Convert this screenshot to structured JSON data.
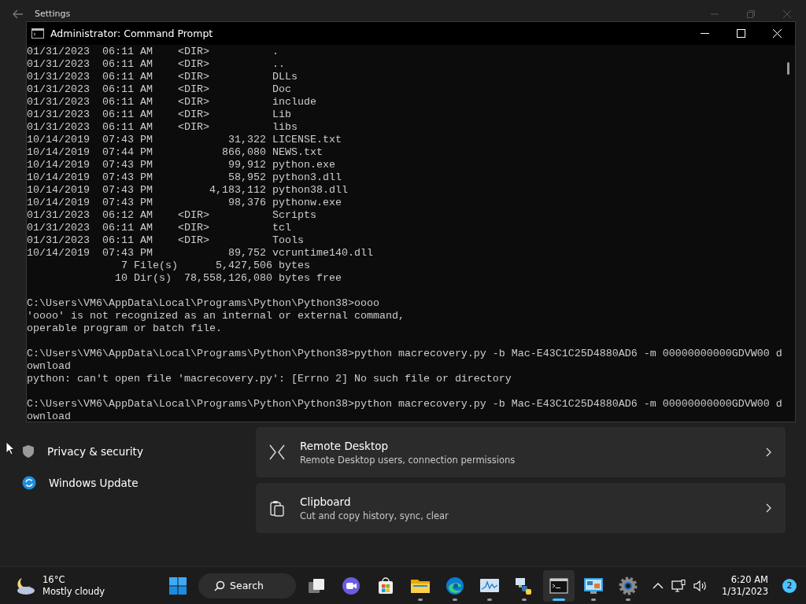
{
  "settings": {
    "title": "Settings",
    "nav": [
      {
        "label": "Privacy & security",
        "kind": "privacy"
      },
      {
        "label": "Windows Update",
        "kind": "update"
      }
    ],
    "cards": [
      {
        "title": "Remote Desktop",
        "description": "Remote Desktop users, connection permissions",
        "kind": "remote"
      },
      {
        "title": "Clipboard",
        "description": "Cut and copy history, sync, clear",
        "kind": "clipboard"
      }
    ]
  },
  "console": {
    "title": "Administrator:  Command Prompt",
    "blocks": [
      [
        "01/31/2023  06:11 AM    <DIR>          .",
        "01/31/2023  06:11 AM    <DIR>          ..",
        "01/31/2023  06:11 AM    <DIR>          DLLs",
        "01/31/2023  06:11 AM    <DIR>          Doc",
        "01/31/2023  06:11 AM    <DIR>          include",
        "01/31/2023  06:11 AM    <DIR>          Lib",
        "01/31/2023  06:11 AM    <DIR>          libs",
        "10/14/2019  07:43 PM            31,322 LICENSE.txt",
        "10/14/2019  07:44 PM           866,080 NEWS.txt",
        "10/14/2019  07:43 PM            99,912 python.exe",
        "10/14/2019  07:43 PM            58,952 python3.dll",
        "10/14/2019  07:43 PM         4,183,112 python38.dll",
        "10/14/2019  07:43 PM            98,376 pythonw.exe",
        "01/31/2023  06:12 AM    <DIR>          Scripts",
        "01/31/2023  06:11 AM    <DIR>          tcl",
        "01/31/2023  06:11 AM    <DIR>          Tools",
        "10/14/2019  07:43 PM            89,752 vcruntime140.dll",
        "               7 File(s)      5,427,506 bytes",
        "              10 Dir(s)  78,558,126,080 bytes free"
      ],
      [
        "C:\\Users\\VM6\\AppData\\Local\\Programs\\Python\\Python38>oooo",
        "'oooo' is not recognized as an internal or external command,",
        "operable program or batch file."
      ],
      [
        "C:\\Users\\VM6\\AppData\\Local\\Programs\\Python\\Python38>python macrecovery.py -b Mac-E43C1C25D4880AD6 -m 00000000000GDVW00 d",
        "ownload",
        "python: can't open file 'macrecovery.py': [Errno 2] No such file or directory"
      ],
      [
        "C:\\Users\\VM6\\AppData\\Local\\Programs\\Python\\Python38>python macrecovery.py -b Mac-E43C1C25D4880AD6 -m 00000000000GDVW00 d",
        "ownload"
      ]
    ]
  },
  "taskbar": {
    "weather": {
      "temperature": "16°C",
      "condition": "Mostly cloudy"
    },
    "search": {
      "label": "Search"
    },
    "apps": [
      {
        "kind": "taskview",
        "running": false,
        "active": false
      },
      {
        "kind": "chat",
        "running": false,
        "active": false
      },
      {
        "kind": "store",
        "running": false,
        "active": false
      },
      {
        "kind": "explorer",
        "running": true,
        "active": false
      },
      {
        "kind": "edge",
        "running": true,
        "active": false
      },
      {
        "kind": "monitor",
        "running": true,
        "active": false
      },
      {
        "kind": "python",
        "running": true,
        "active": false
      },
      {
        "kind": "terminal",
        "running": true,
        "active": true
      },
      {
        "kind": "remote",
        "running": true,
        "active": false
      },
      {
        "kind": "settings",
        "running": true,
        "active": false
      }
    ],
    "clock": {
      "time": "6:20 AM",
      "date": "1/31/2023"
    },
    "notifications": "2"
  }
}
